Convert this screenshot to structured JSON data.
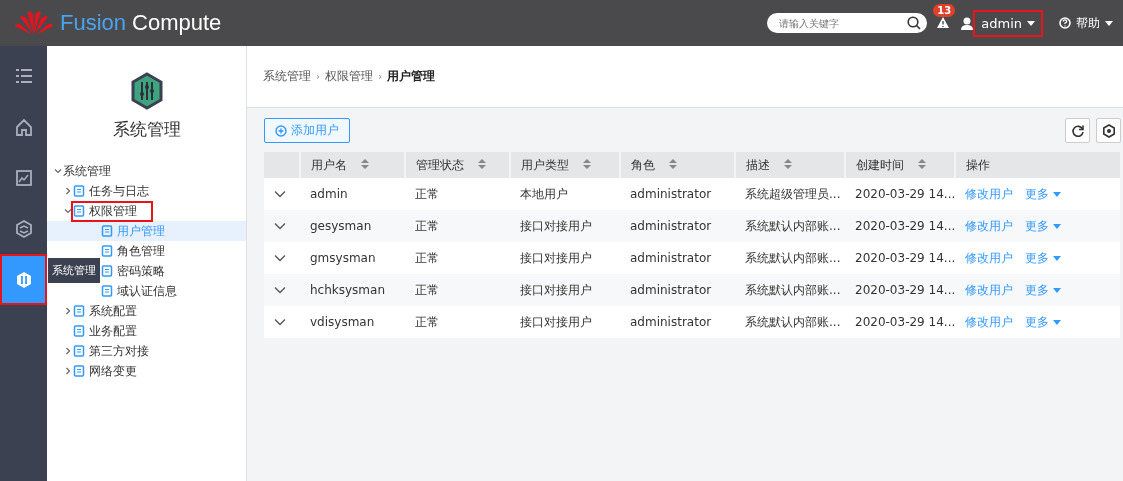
{
  "header": {
    "brand_primary": "Fusion",
    "brand_secondary": "Compute",
    "search": {
      "placeholder": "请输入关键字"
    },
    "alarm_count": "13",
    "user": {
      "label": "admin",
      "highlighted": true
    },
    "help": "帮助"
  },
  "rail": {
    "items": [
      {
        "selected": false,
        "highlighted": false
      },
      {
        "selected": false,
        "highlighted": false
      },
      {
        "selected": false,
        "highlighted": false
      },
      {
        "selected": false,
        "highlighted": false
      },
      {
        "selected": true,
        "highlighted": true
      }
    ],
    "tooltip": "系统管理"
  },
  "sidebar": {
    "title": "系统管理",
    "tree": [
      {
        "label": "系统管理",
        "expanded": true,
        "children": [
          {
            "label": "任务与日志",
            "expanded": false,
            "highlighted": false
          },
          {
            "label": "权限管理",
            "expanded": true,
            "highlighted": true,
            "children": [
              {
                "label": "用户管理",
                "selected": true
              },
              {
                "label": "角色管理",
                "selected": false
              },
              {
                "label": "密码策略",
                "selected": false
              },
              {
                "label": "域认证信息",
                "selected": false
              }
            ]
          },
          {
            "label": "系统配置",
            "expanded": false,
            "highlighted": false
          },
          {
            "label": "业务配置",
            "highlighted": false
          },
          {
            "label": "第三方对接",
            "expanded": false,
            "highlighted": false
          },
          {
            "label": "网络变更",
            "expanded": false,
            "highlighted": false
          }
        ]
      }
    ]
  },
  "breadcrumb": {
    "items": [
      "系统管理",
      "权限管理",
      "用户管理"
    ],
    "separator": "›"
  },
  "toolbar": {
    "add_button": "添加用户"
  },
  "table": {
    "columns": [
      {
        "label": "用户名",
        "sortable": true
      },
      {
        "label": "管理状态",
        "sortable": true
      },
      {
        "label": "用户类型",
        "sortable": true
      },
      {
        "label": "角色",
        "sortable": true
      },
      {
        "label": "描述",
        "sortable": true
      },
      {
        "label": "创建时间",
        "sortable": true
      },
      {
        "label": "操作",
        "sortable": false
      }
    ],
    "rows": [
      {
        "cells": [
          "admin",
          "正常",
          "本地用户",
          "administrator",
          "系统超级管理员...",
          "2020-03-29 14..."
        ],
        "actions": [
          "修改用户",
          "更多"
        ]
      },
      {
        "cells": [
          "gesysman",
          "正常",
          "接口对接用户",
          "administrator",
          "系统默认内部账...",
          "2020-03-29 14..."
        ],
        "actions": [
          "修改用户",
          "更多"
        ]
      },
      {
        "cells": [
          "gmsysman",
          "正常",
          "接口对接用户",
          "administrator",
          "系统默认内部账...",
          "2020-03-29 14..."
        ],
        "actions": [
          "修改用户",
          "更多"
        ]
      },
      {
        "cells": [
          "hchksysman",
          "正常",
          "接口对接用户",
          "administrator",
          "系统默认内部账...",
          "2020-03-29 14..."
        ],
        "actions": [
          "修改用户",
          "更多"
        ]
      },
      {
        "cells": [
          "vdisysman",
          "正常",
          "接口对接用户",
          "administrator",
          "系统默认内部账...",
          "2020-03-29 14..."
        ],
        "actions": [
          "修改用户",
          "更多"
        ]
      }
    ]
  }
}
